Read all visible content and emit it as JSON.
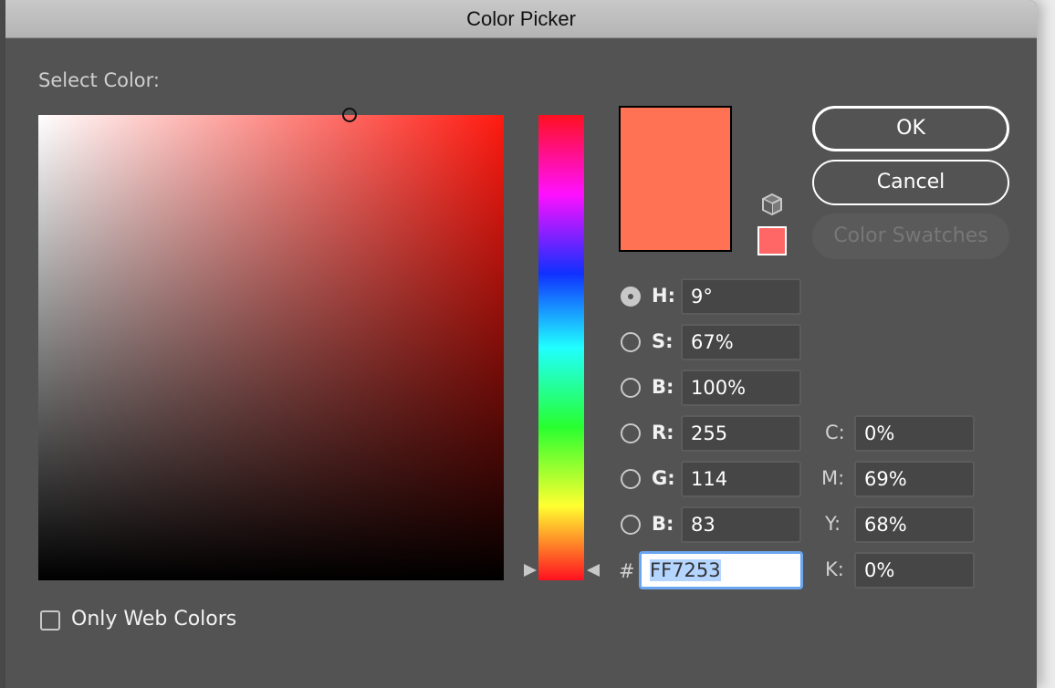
{
  "window": {
    "title": "Color Picker"
  },
  "picker": {
    "select_label": "Select Color:",
    "hue_degrees": 9,
    "saturation_pct": 67,
    "brightness_pct": 100,
    "current_color": "#ff7253",
    "web_safe_color": "#ff6666",
    "out_of_gamut_icon": "cube-icon"
  },
  "buttons": {
    "ok": "OK",
    "cancel": "Cancel",
    "swatches": "Color Swatches"
  },
  "hsb": [
    {
      "label": "H:",
      "value": "9°",
      "selected": true
    },
    {
      "label": "S:",
      "value": "67%",
      "selected": false
    },
    {
      "label": "B:",
      "value": "100%",
      "selected": false
    }
  ],
  "rgb": [
    {
      "label": "R:",
      "value": "255",
      "selected": false
    },
    {
      "label": "G:",
      "value": "114",
      "selected": false
    },
    {
      "label": "B:",
      "value": "83",
      "selected": false
    }
  ],
  "cmyk": [
    {
      "label": "C:",
      "value": "0%"
    },
    {
      "label": "M:",
      "value": "69%"
    },
    {
      "label": "Y:",
      "value": "68%"
    },
    {
      "label": "K:",
      "value": "0%"
    }
  ],
  "hex": {
    "prefix": "#",
    "value": "FF7253"
  },
  "options": {
    "only_web_colors_label": "Only Web Colors",
    "only_web_colors_checked": false
  }
}
